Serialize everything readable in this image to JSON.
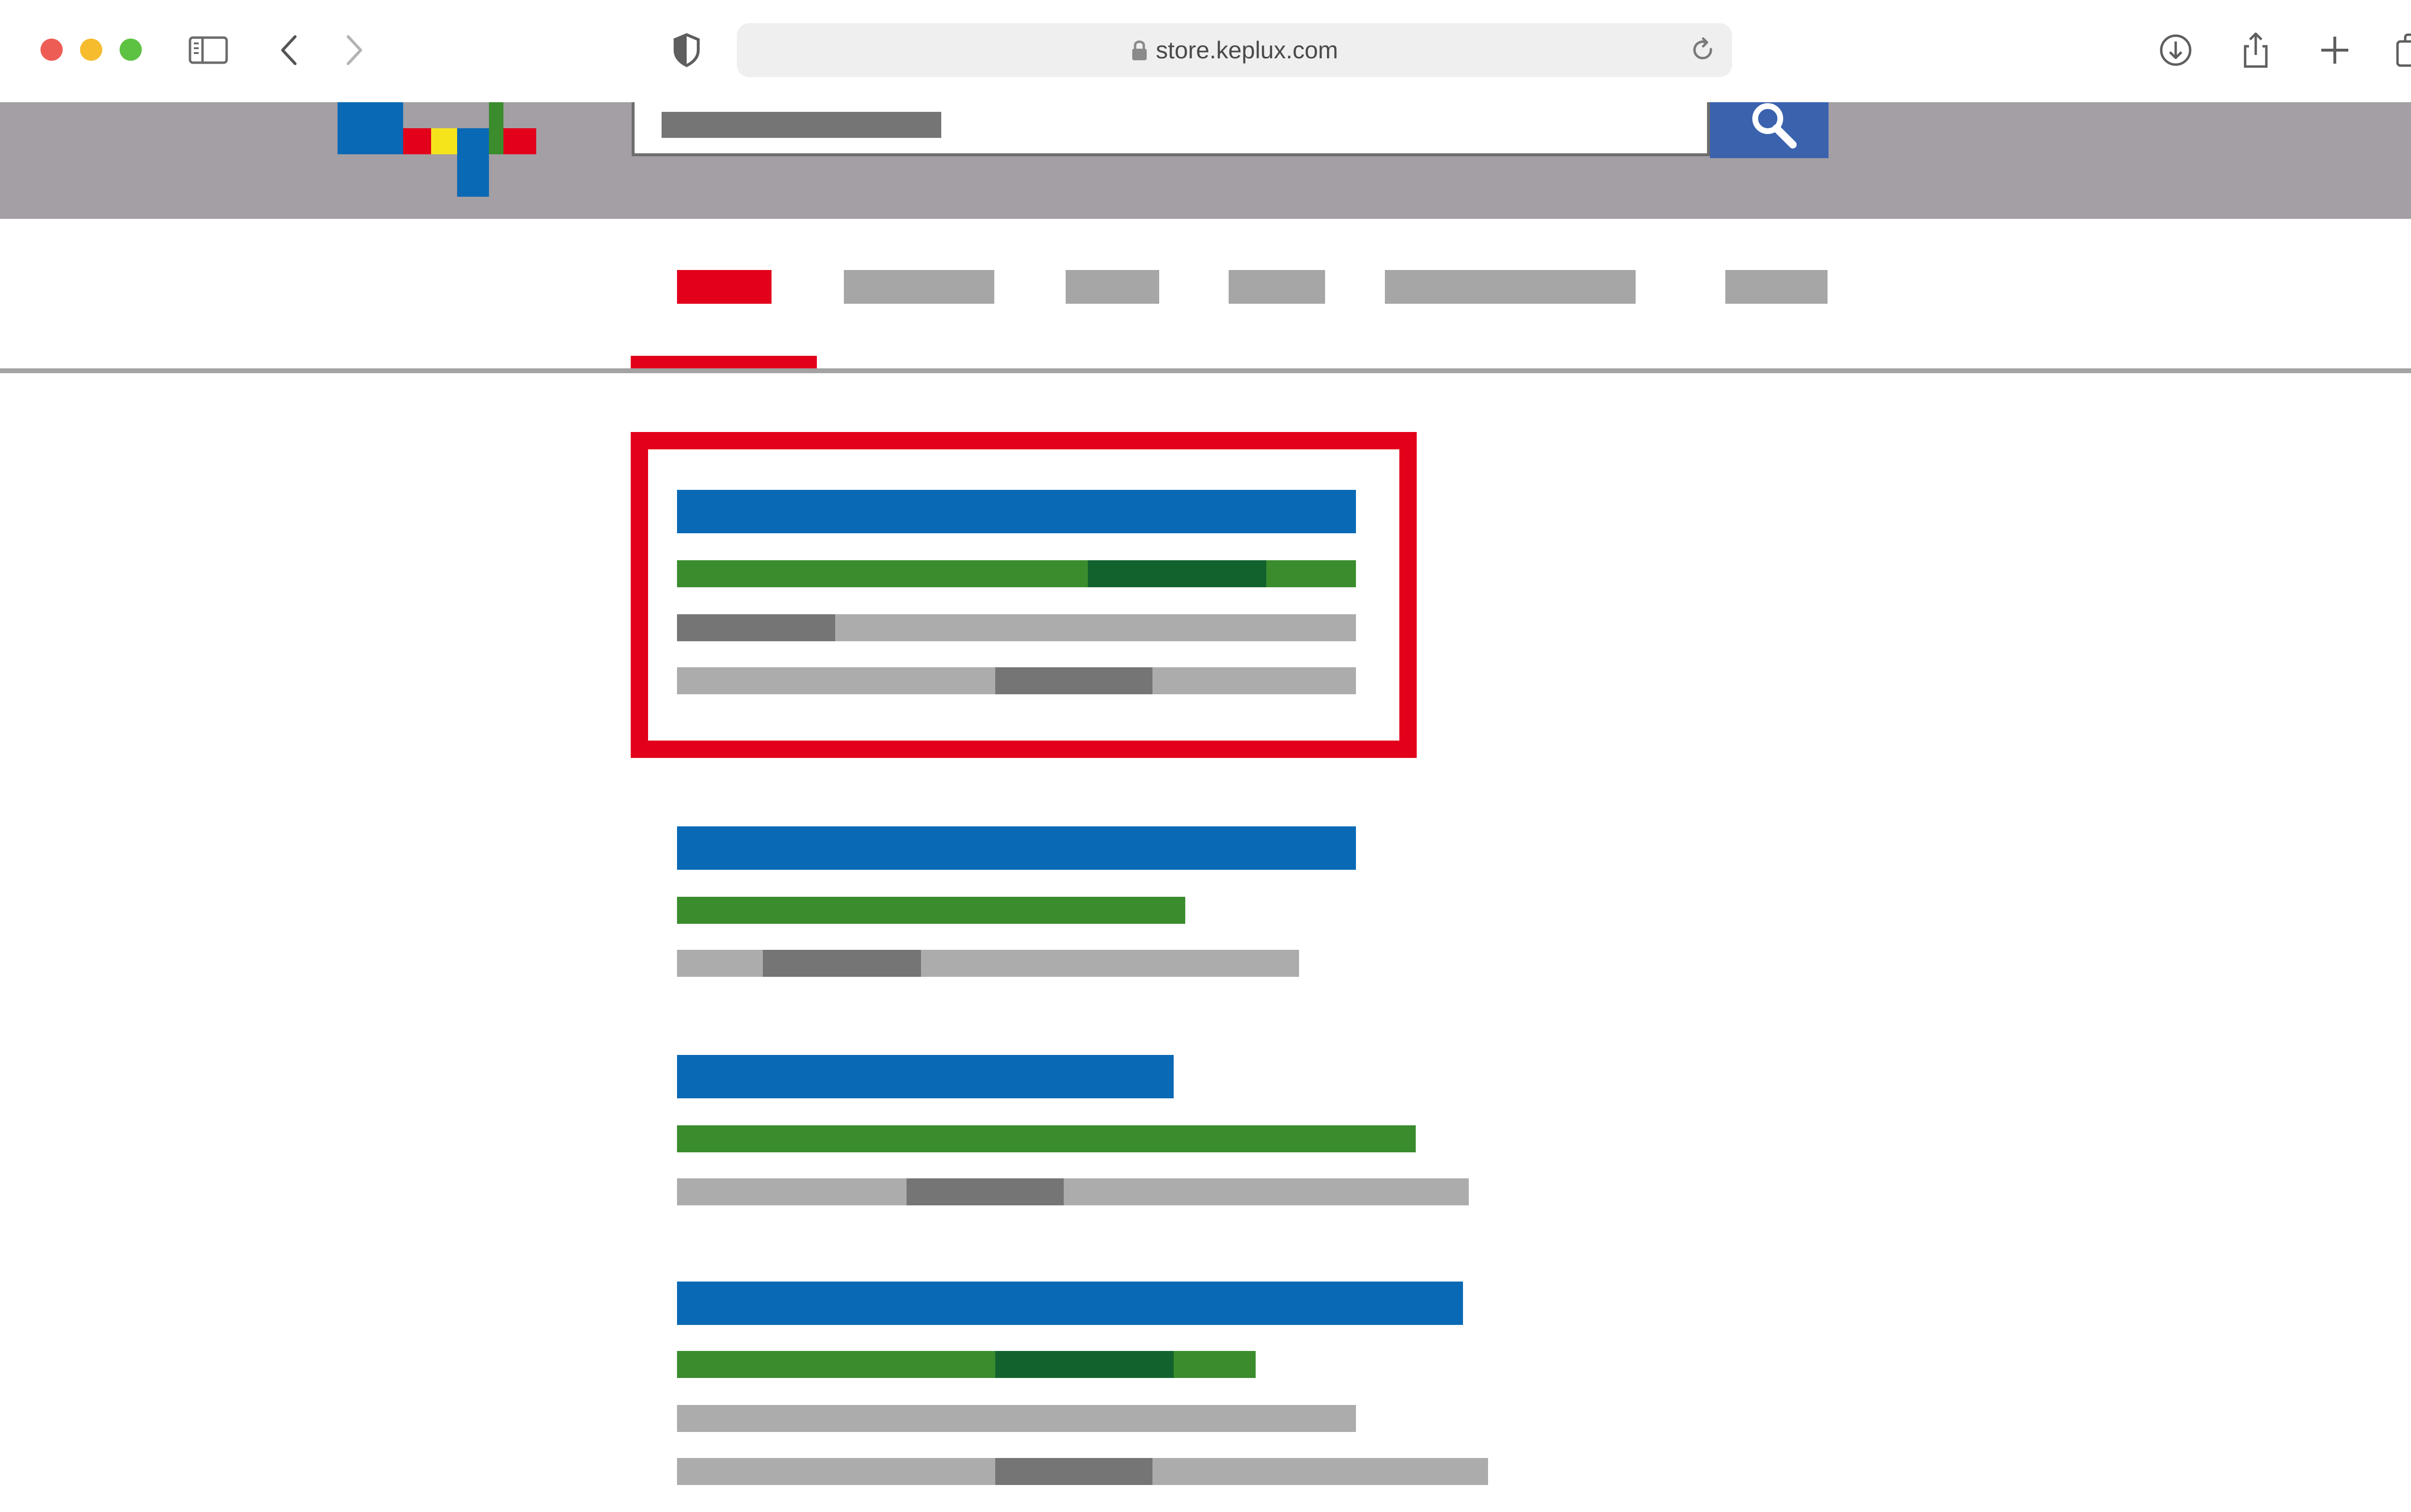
{
  "browser": {
    "url": "store.keplux.com",
    "traffic_lights": [
      "#ee5d55",
      "#f6bc2e",
      "#5dc142"
    ],
    "icons": [
      "sidebar-icon",
      "back-icon",
      "forward-icon",
      "shield-icon",
      "lock-icon",
      "reload-icon",
      "download-icon",
      "share-icon",
      "new-tab-icon",
      "tabs-overview-icon"
    ]
  },
  "site": {
    "logo_colors": [
      "#0a69b5",
      "#e2001a",
      "#f5e41c",
      "#3a8c2d"
    ],
    "search": {
      "placeholder": "",
      "button_icon": "search-icon"
    },
    "nav": {
      "active_index": 0,
      "item_count": 6,
      "active_color": "#e2001a"
    }
  },
  "results": {
    "highlight_color": "#e2001a",
    "count": 4
  }
}
